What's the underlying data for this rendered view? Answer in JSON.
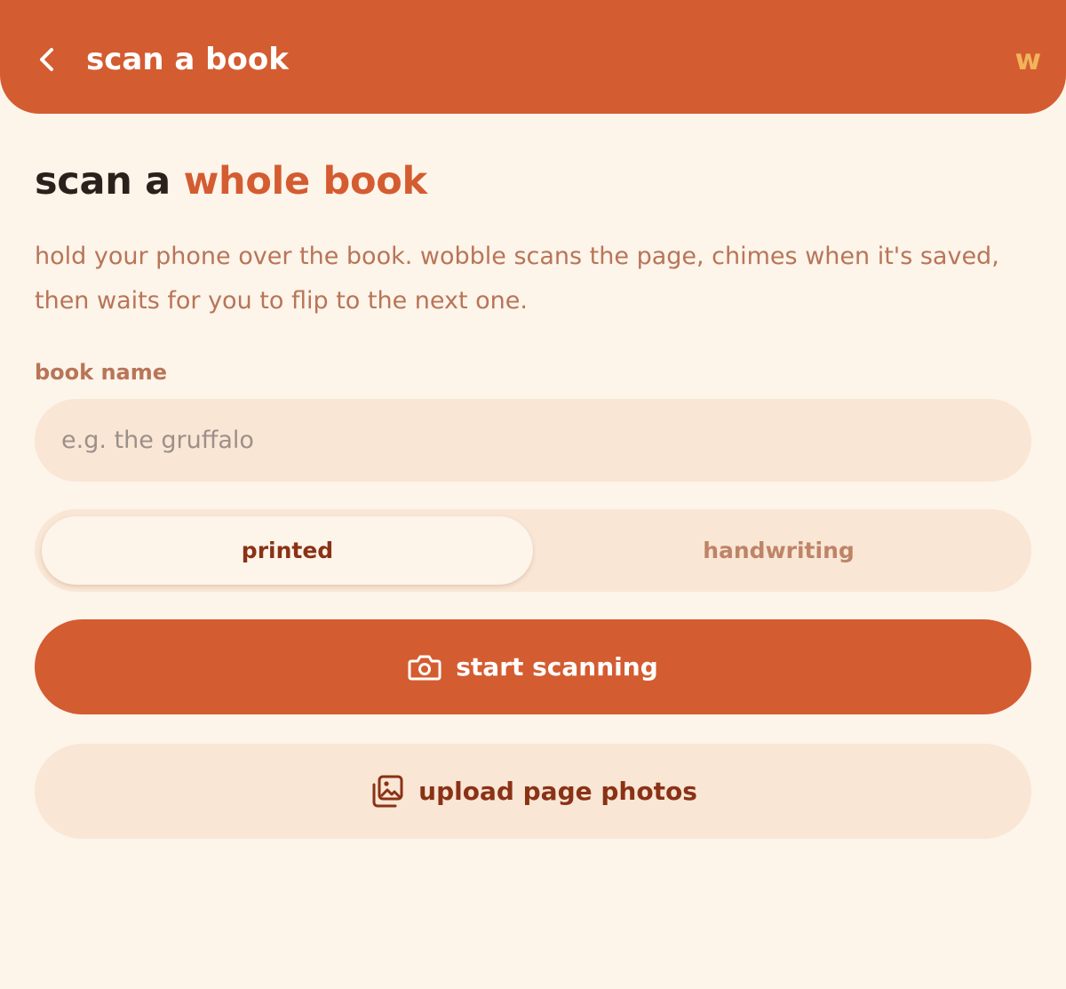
{
  "header": {
    "title": "scan a book",
    "logo_text": "w",
    "back_icon": "chevron-left-icon"
  },
  "main": {
    "headline_prefix": "scan a ",
    "headline_accent": "whole book",
    "description": "hold your phone over the book. wobble scans the page, chimes when it's saved, then waits for you to flip to the next one.",
    "book_name_label": "book name",
    "book_name_placeholder": "e.g. the gruffalo",
    "book_name_value": "",
    "mode_options": [
      {
        "label": "printed",
        "selected": true
      },
      {
        "label": "handwriting",
        "selected": false
      }
    ],
    "start_button": {
      "label": "start scanning",
      "icon": "camera-icon"
    },
    "upload_button": {
      "label": "upload page photos",
      "icon": "photo-gallery-icon"
    }
  },
  "colors": {
    "brand": "#d45c31",
    "background": "#fdf4ea",
    "field_background": "#f9e6d5",
    "logo": "#f2b45a",
    "muted_text": "#b87557",
    "dark_accent": "#8a3216"
  }
}
